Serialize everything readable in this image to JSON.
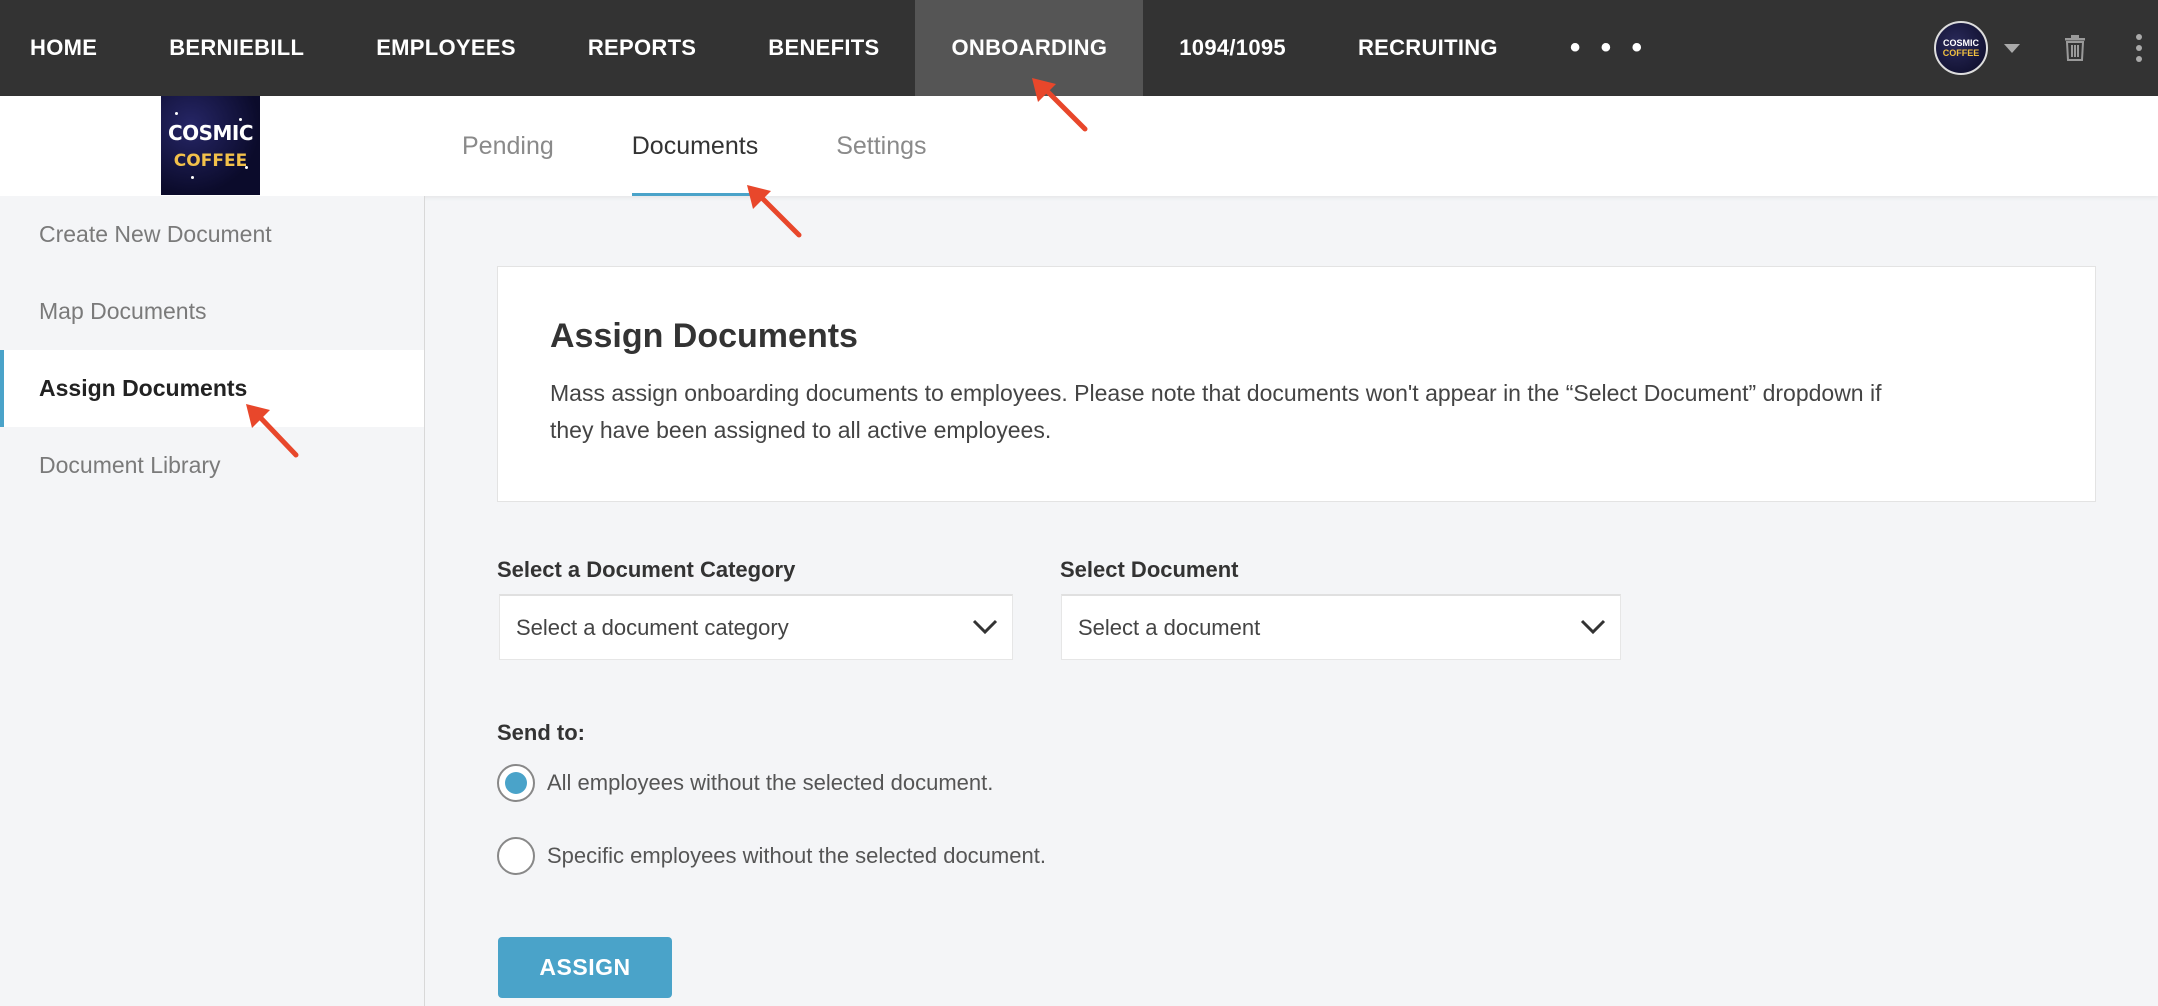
{
  "topnav": {
    "items": [
      "HOME",
      "BERNIEBILL",
      "EMPLOYEES",
      "REPORTS",
      "BENEFITS",
      "ONBOARDING",
      "1094/1095",
      "RECRUITING"
    ],
    "active": "ONBOARDING",
    "more_label": "• • •",
    "avatar": {
      "line1": "COSMIC",
      "line2": "COFFEE"
    },
    "icons": [
      "chevron-down-icon",
      "trash-icon",
      "kebab-menu-icon"
    ]
  },
  "logo": {
    "line1": "COSMIC",
    "line2": "COFFEE"
  },
  "tabs": [
    "Pending",
    "Documents",
    "Settings"
  ],
  "active_tab": "Documents",
  "sidebar": {
    "items": [
      "Create New Document",
      "Map Documents",
      "Assign Documents",
      "Document Library"
    ],
    "active": "Assign Documents"
  },
  "card": {
    "title": "Assign Documents",
    "description": "Mass assign onboarding documents to employees. Please note that documents won't appear in the “Select Document” dropdown if they have been assigned to all active employees."
  },
  "form": {
    "category_label": "Select a Document Category",
    "category_placeholder": "Select a document category",
    "document_label": "Select Document",
    "document_placeholder": "Select a document",
    "send_to_label": "Send to:",
    "options": [
      {
        "label": "All employees without the selected document.",
        "selected": true
      },
      {
        "label": "Specific employees without the selected document.",
        "selected": false
      }
    ],
    "assign_label": "ASSIGN"
  },
  "colors": {
    "nav_bg": "#333333",
    "nav_active_bg": "#555555",
    "accent": "#4aa3c9",
    "annotation_arrow": "#e8472b"
  }
}
